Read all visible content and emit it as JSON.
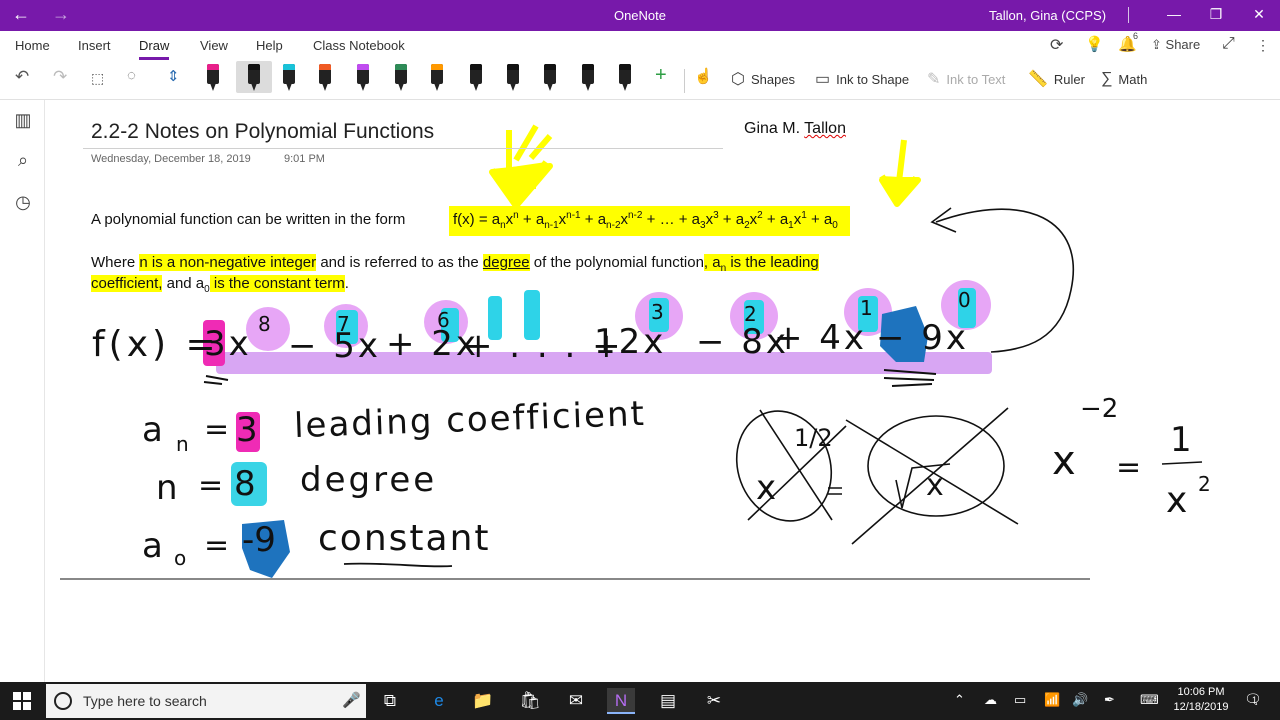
{
  "window": {
    "title": "OneNote",
    "user": "Tallon, Gina (CCPS)",
    "back_glyph": "←",
    "forward_glyph": "→",
    "minimize_glyph": "—",
    "restore_glyph": "❐",
    "close_glyph": "✕"
  },
  "ribbon": {
    "tabs": [
      "Home",
      "Insert",
      "Draw",
      "View",
      "Help",
      "Class Notebook"
    ],
    "active_tab": "Draw",
    "share_label": "Share",
    "notification_count": "6",
    "tools": {
      "shapes": "Shapes",
      "ink_to_shape": "Ink to Shape",
      "ink_to_text": "Ink to Text",
      "ruler": "Ruler",
      "math": "Math"
    },
    "pen_colors": [
      "#e8208a",
      "#111111",
      "#19c2d8",
      "#f05a24",
      "#c04cf0",
      "#2e8b57",
      "#ff9900",
      "#111111",
      "#111111",
      "#111111",
      "#111111",
      "#111111"
    ]
  },
  "page": {
    "title": "2.2-2 Notes on Polynomial Functions",
    "date": "Wednesday, December 18, 2019",
    "time": "9:01 PM",
    "author_first": "Gina M. ",
    "author_last": "Tallon",
    "intro": "A polynomial function can be written in the form",
    "formula": {
      "lhs": "f(x) = ",
      "terms": [
        {
          "c": "a",
          "cs": "n",
          "v": "x",
          "e": "n"
        },
        {
          "c": "a",
          "cs": "n-1",
          "v": "x",
          "e": "n-1"
        },
        {
          "c": "a",
          "cs": "n-2",
          "v": "x",
          "e": "n-2"
        },
        {
          "c": "…",
          "cs": "",
          "v": "",
          "e": ""
        },
        {
          "c": "a",
          "cs": "3",
          "v": "x",
          "e": "3"
        },
        {
          "c": "a",
          "cs": "2",
          "v": "x",
          "e": "2"
        },
        {
          "c": "a",
          "cs": "1",
          "v": "x",
          "e": "1"
        },
        {
          "c": "a",
          "cs": "0",
          "v": "",
          "e": ""
        }
      ]
    },
    "where": {
      "w0": "Where ",
      "w1": "n is a non-negative integer",
      "w2": " and is referred to as the ",
      "w3": "degree",
      "w4": " of the polynomial function",
      "w5": ", a",
      "w5sub": "n",
      "w6": " is the leading",
      "w7": "coefficient,",
      "w8": " and a",
      "w8sub": "0",
      "w9": " is the constant term",
      "w10": "."
    },
    "handwriting": {
      "equation_lhs": "f(x) =",
      "terms": [
        "3x",
        "− 5x",
        "+ 2x",
        "+ . . . +",
        "12x",
        "− 8x",
        "+ 4x",
        "− 9x"
      ],
      "exponents": [
        "8",
        "7",
        "6",
        "3",
        "2",
        "1",
        "0"
      ],
      "an_label": "a",
      "an_sub": "n",
      "an_value": "3",
      "an_desc": "leading coefficient",
      "n_label": "n",
      "n_value": "8",
      "n_desc": "degree",
      "a0_label": "a",
      "a0_sub": "o",
      "a0_value": "-9",
      "a0_desc": "constant",
      "half_exp": "1/2",
      "x": "x",
      "neg2": "−2",
      "one": "1",
      "x2": "x",
      "two": "2"
    }
  },
  "taskbar": {
    "search_placeholder": "Type here to search",
    "time": "10:06 PM",
    "date": "12/18/2019",
    "notification_count": "1"
  }
}
